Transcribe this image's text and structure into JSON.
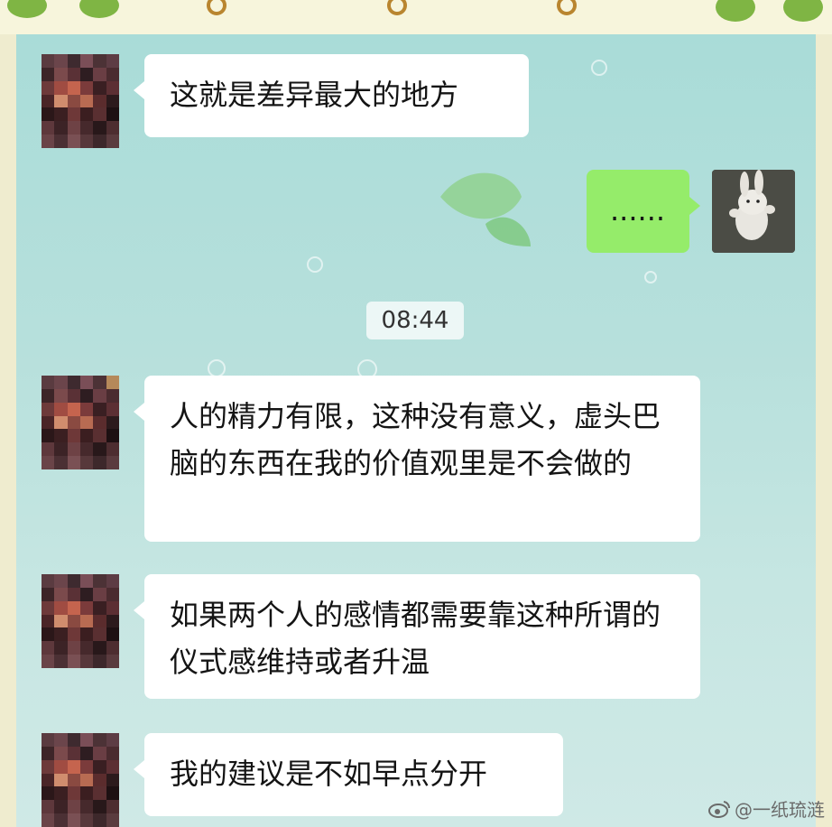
{
  "messages": [
    {
      "sender": "contact",
      "text": "这就是差异最大的地方"
    },
    {
      "sender": "self",
      "text": "......"
    },
    {
      "sender": "contact",
      "text": "人的精力有限，这种没有意义，虚头巴脑的东西在我的价值观里是不会做的"
    },
    {
      "sender": "contact",
      "text": "如果两个人的感情都需要靠这种所谓的仪式感维持或者升温"
    },
    {
      "sender": "contact",
      "text": "我的建议是不如早点分开"
    }
  ],
  "timestamp": "08:44",
  "watermark": "@一纸琉涟",
  "icons": {
    "contact_avatar": "pixelated-avatar",
    "self_avatar": "rabbit-avatar",
    "watermark_icon": "weibo-icon"
  },
  "colors": {
    "self_bubble": "#95ec6a",
    "contact_bubble": "#ffffff",
    "chat_background": "#b7e0dc"
  }
}
